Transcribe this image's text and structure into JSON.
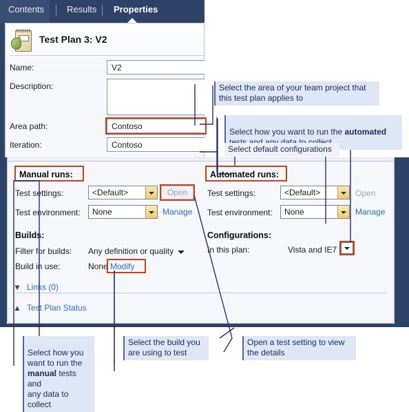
{
  "tabs": [
    {
      "label": "Contents",
      "active": false
    },
    {
      "label": "Results",
      "active": false
    },
    {
      "label": "Properties",
      "active": true
    }
  ],
  "plan": {
    "icon": "test-plan-icon",
    "title": "Test Plan 3: V2",
    "fields": {
      "name_label": "Name:",
      "name_value": "V2",
      "description_label": "Description:",
      "description_value": "",
      "area_path_label": "Area path:",
      "area_path_value": "Contoso",
      "iteration_label": "Iteration:",
      "iteration_value": "Contoso"
    }
  },
  "manual": {
    "section_title": "Manual runs:",
    "test_settings_label": "Test settings:",
    "test_settings_value": "<Default>",
    "open_button": "Open",
    "test_environment_label": "Test environment:",
    "test_environment_value": "None",
    "manage_link": "Manage",
    "builds_title": "Builds:",
    "filter_label": "Filter for builds:",
    "filter_value": "Any definition or quality",
    "build_in_use_label": "Build in use:",
    "build_in_use_value": "None",
    "modify_link": "Modify"
  },
  "automated": {
    "section_title": "Automated runs:",
    "test_settings_label": "Test settings:",
    "test_settings_value": "<Default>",
    "open_button": "Open",
    "test_environment_label": "Test environment:",
    "test_environment_value": "None",
    "manage_link": "Manage",
    "configurations_title": "Configurations:",
    "in_this_plan_label": "In this plan:",
    "in_this_plan_value": "Vista and IE7"
  },
  "disclosure": {
    "links_label": "Links (0)",
    "links_icon": "chevron-down-icon",
    "status_label": "Test Plan Status",
    "status_icon": "chevron-up-icon"
  },
  "callouts": {
    "area": "Select the area of your team project that\nthis test plan applies to",
    "automated_pre": "Select how you want to run the ",
    "automated_bold": "automated",
    "automated_post": "\ntests and any data to collect",
    "configurations": "Select default configurations",
    "manual_pre": "Select how you\nwant to run the\n",
    "manual_bold": "manual",
    "manual_post": " tests and\nany data to collect",
    "build": "Select the build you\nare using to test",
    "open_setting": "Open a test setting to view\nthe details"
  },
  "colors": {
    "chrome_blue": "#2f4369",
    "panel_bg": "#f6f7fb",
    "highlight_red": "#c5451b",
    "link_blue": "#2a6fc9",
    "callout_bg": "#dfe6f5",
    "callout_text": "#1d2a5c",
    "dropdown_amber": "#f0cd74"
  }
}
